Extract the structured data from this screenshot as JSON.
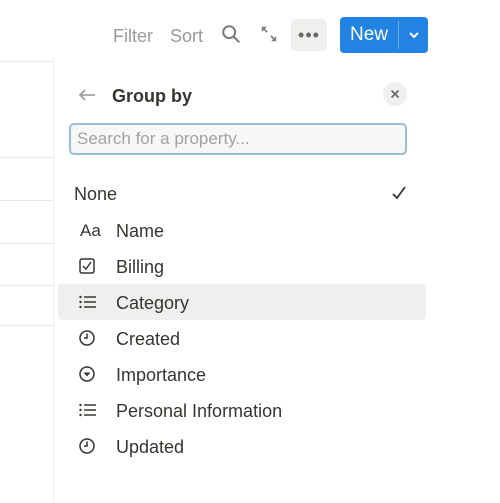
{
  "toolbar": {
    "filter_label": "Filter",
    "sort_label": "Sort",
    "search_icon": "search-icon",
    "expand_icon": "expand-icon",
    "more_icon": "more-icon",
    "new_label": "New",
    "accent_color": "#2383e2"
  },
  "panel": {
    "title": "Group by",
    "search_placeholder": "Search for a property...",
    "none_label": "None",
    "none_selected": true,
    "options": [
      {
        "label": "Name",
        "icon": "text-aa-icon"
      },
      {
        "label": "Billing",
        "icon": "checkbox-icon"
      },
      {
        "label": "Category",
        "icon": "list-icon",
        "highlighted": true
      },
      {
        "label": "Created",
        "icon": "clock-icon"
      },
      {
        "label": "Importance",
        "icon": "select-icon"
      },
      {
        "label": "Personal Information",
        "icon": "list-icon"
      },
      {
        "label": "Updated",
        "icon": "clock-icon"
      }
    ]
  }
}
